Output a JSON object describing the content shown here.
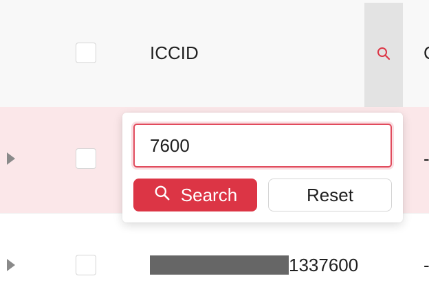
{
  "table": {
    "header": {
      "column_title": "ICCID",
      "next_column_partial": "C"
    },
    "rows": [
      {
        "value_prefix_redacted": true,
        "value": "",
        "next_column_partial": "-"
      },
      {
        "value_prefix_redacted": true,
        "value": "1337600",
        "next_column_partial": "-"
      }
    ]
  },
  "filter_dropdown": {
    "search_value": "7600",
    "search_label": "Search",
    "reset_label": "Reset"
  },
  "colors": {
    "accent": "#dc3545",
    "row_highlight": "#fbe7e9",
    "header_bg": "#f8f8f8"
  },
  "icons": {
    "filter": "search-icon",
    "button": "search-icon",
    "expand": "caret-right-icon"
  }
}
